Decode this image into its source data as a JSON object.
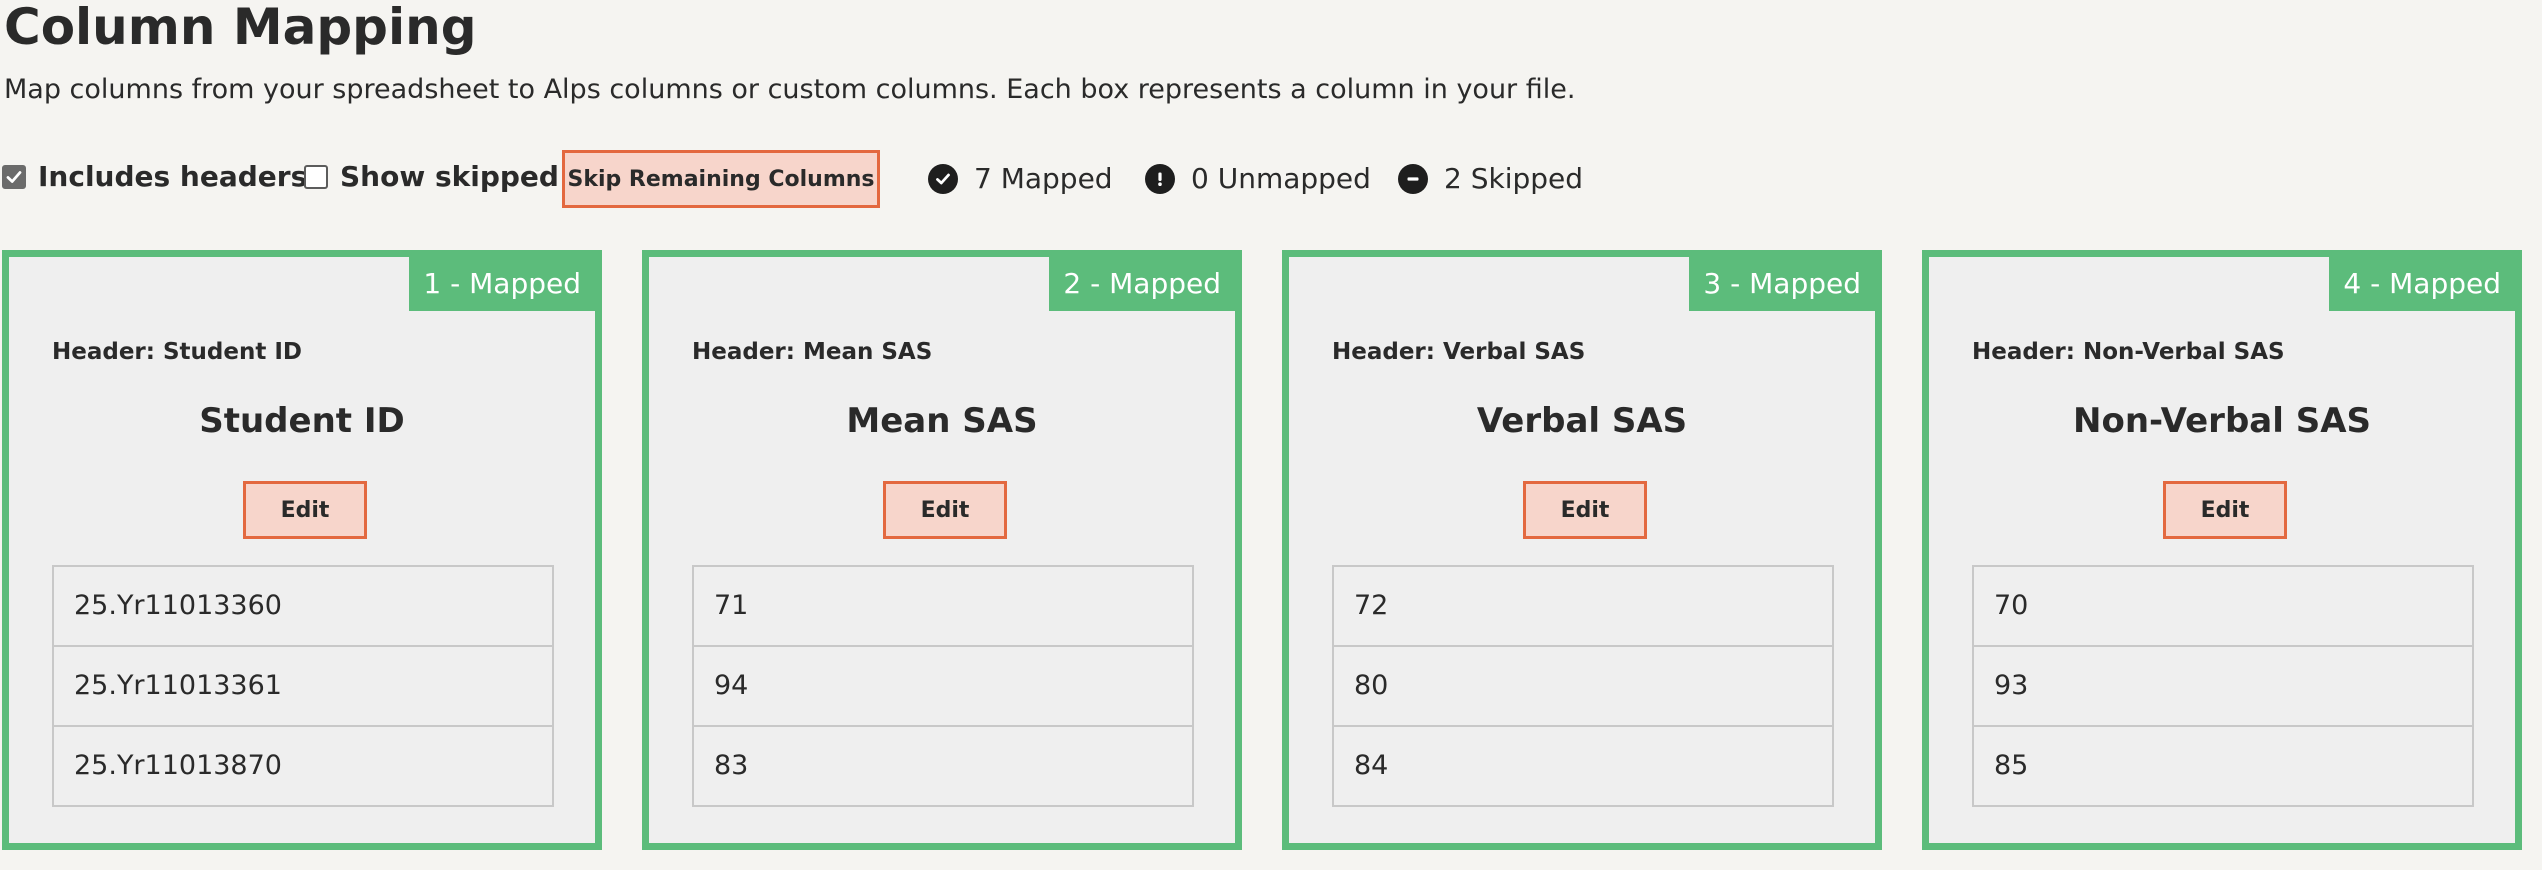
{
  "page": {
    "title": "Column Mapping",
    "subtitle": "Map columns from your spreadsheet to Alps columns or custom columns. Each box represents a column in your file."
  },
  "toolbar": {
    "includes_headers_label": "Includes headers",
    "includes_headers_checked": true,
    "show_skipped_label": "Show skipped",
    "show_skipped_checked": false,
    "skip_button_label": "Skip Remaining Columns",
    "mapped_text": "7 Mapped",
    "unmapped_text": "0 Unmapped",
    "skipped_text": "2 Skipped",
    "mapped_icon": "check-circle-icon",
    "unmapped_icon": "exclamation-circle-icon",
    "skipped_icon": "minus-circle-icon"
  },
  "colors": {
    "mapped_border": "#5cbc7b",
    "button_fill": "#f7d5cb",
    "button_border": "#e3683f"
  },
  "cards": [
    {
      "badge": "1 - Mapped",
      "header_label": "Header: Student ID",
      "title": "Student ID",
      "edit_label": "Edit",
      "samples": [
        "25.Yr11013360",
        "25.Yr11013361",
        "25.Yr11013870"
      ]
    },
    {
      "badge": "2 - Mapped",
      "header_label": "Header: Mean SAS",
      "title": "Mean SAS",
      "edit_label": "Edit",
      "samples": [
        "71",
        "94",
        "83"
      ]
    },
    {
      "badge": "3 - Mapped",
      "header_label": "Header: Verbal SAS",
      "title": "Verbal SAS",
      "edit_label": "Edit",
      "samples": [
        "72",
        "80",
        "84"
      ]
    },
    {
      "badge": "4 - Mapped",
      "header_label": "Header: Non-Verbal SAS",
      "title": "Non-Verbal SAS",
      "edit_label": "Edit",
      "samples": [
        "70",
        "93",
        "85"
      ]
    }
  ]
}
